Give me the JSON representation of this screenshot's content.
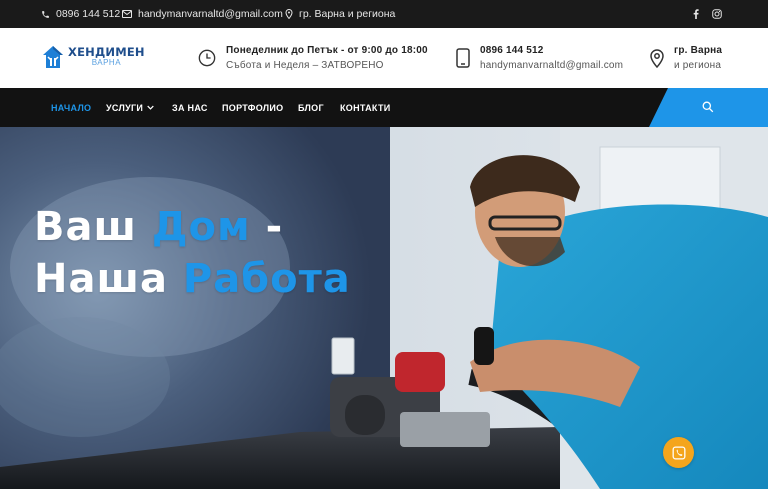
{
  "topbar": {
    "phone": "0896 144 512",
    "email": "handymanvarnaltd@gmail.com",
    "location": "гр. Варна и региона",
    "social": [
      "facebook-icon",
      "instagram-icon"
    ]
  },
  "header": {
    "logo_name": "ХЕНДИМЕН",
    "logo_sub": "ВАРНА",
    "hours_line1": "Понеделник до Петък - от 9:00 до 18:00",
    "hours_line2": "Събота и Неделя – ЗАТВОРЕНО",
    "contact_phone": "0896 144 512",
    "contact_email": "handymanvarnaltd@gmail.com",
    "city_line1": "гр. Варна",
    "city_line2": "и региона"
  },
  "nav": {
    "items": [
      {
        "label": "НАЧАЛО",
        "active": true
      },
      {
        "label": "УСЛУГИ",
        "has_dropdown": true
      },
      {
        "label": "ЗА НАС"
      },
      {
        "label": "ПОРТФОЛИО"
      },
      {
        "label": "БЛОГ"
      },
      {
        "label": "КОНТАКТИ"
      }
    ],
    "search_icon": "search-icon"
  },
  "hero": {
    "line1_a": "Ваш ",
    "line1_b": "Дом",
    "line1_c": " -",
    "line2_a": "Наша ",
    "line2_b": "Работа"
  },
  "colors": {
    "accent": "#1e95e8",
    "dark": "#121212",
    "fab": "#f4a51c"
  },
  "fab_icon": "phone-icon"
}
